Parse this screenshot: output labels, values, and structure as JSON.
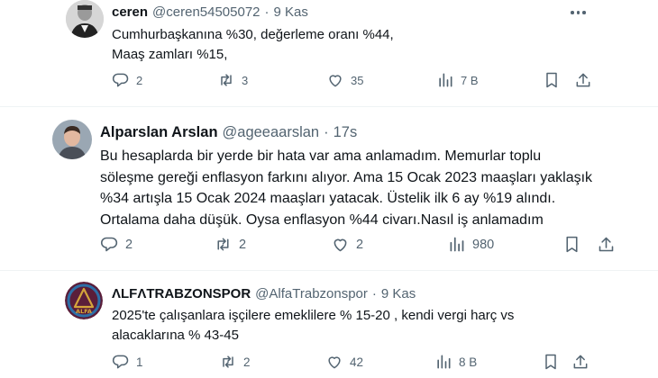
{
  "tweets": [
    {
      "name": "ceren",
      "handle": "@ceren54505072",
      "sep": "·",
      "time": "9 Kas",
      "lines": [
        "Cumhurbaşkanına %30, değerleme oranı %44,",
        "Maaş zamları %15,"
      ],
      "replies": "2",
      "retweets": "3",
      "likes": "35",
      "views": "7 B"
    },
    {
      "name": "Alparslan Arslan",
      "handle": "@ageeaarslan",
      "sep": "·",
      "time": "17s",
      "lines": [
        "Bu hesaplarda bir yerde bir hata var ama anlamadım. Memurlar toplu",
        "söleşme gereği enflasyon farkını alıyor. Ama 15 Ocak 2023 maaşları yaklaşık",
        "%34 artışla 15 Ocak 2024 maaşları yatacak. Üstelik ilk 6 ay %19 alındı.",
        "Ortalama daha düşük. Oysa enflasyon %44 civarı.Nasıl iş anlamadım"
      ],
      "replies": "2",
      "retweets": "2",
      "likes": "2",
      "views": "980"
    },
    {
      "name": "ΛLFΛTRABZONSPOR",
      "handle": "@AlfaTrabzonspor",
      "sep": "·",
      "time": "9 Kas",
      "avatar_text": "ALFA",
      "lines": [
        "2025'te çalışanlara işçilere emeklilere % 15-20 , kendi vergi harç vs",
        "alacaklarına % 43-45"
      ],
      "replies": "1",
      "retweets": "2",
      "likes": "42",
      "views": "8 B"
    }
  ],
  "icons": {
    "reply": "reply-icon",
    "retweet": "retweet-icon",
    "like": "heart-icon",
    "views": "views-icon",
    "bookmark": "bookmark-icon",
    "more": "more-icon"
  },
  "colors": {
    "text": "#0f1419",
    "secondary": "#536471",
    "divider": "#eff3f4",
    "alfa_brand": "#d4a53a",
    "alfa_bg": "#5a1e3a"
  }
}
